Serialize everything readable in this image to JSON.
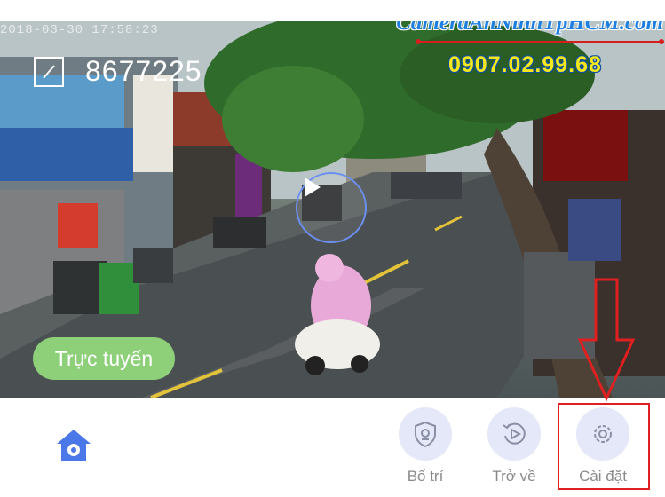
{
  "video": {
    "timestamp": "2018-03-30 17:58:23",
    "watermark": {
      "brand": "CameraAnNinhTpHCM.com",
      "phone": "0907.02.99.68"
    },
    "device_id": "8677225",
    "status_label": "Trực tuyến",
    "icons": {
      "edit": "edit-icon",
      "play": "play-icon"
    }
  },
  "bottom_bar": {
    "home_icon": "home-camera-icon",
    "actions": [
      {
        "label": "Bố trí",
        "icon": "shield-camera-icon"
      },
      {
        "label": "Trở về",
        "icon": "replay-icon"
      },
      {
        "label": "Cài đặt",
        "icon": "gear-icon"
      }
    ]
  },
  "colors": {
    "status_green": "#8ed07a",
    "action_circle": "#e4e8f8",
    "highlight_red": "#e02020",
    "brand_blue": "#1f7fe0",
    "phone_yellow": "#f4e81c"
  }
}
